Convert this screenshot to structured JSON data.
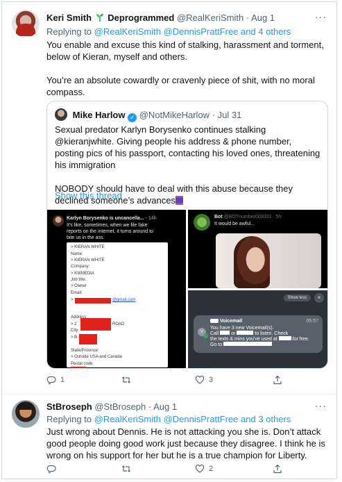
{
  "tweets": [
    {
      "display_name": "Keri Smith",
      "badge": "Deprogrammed",
      "handle": "@RealKeriSmith",
      "sep": "·",
      "date": "Aug 1",
      "replying_prefix": "Replying to",
      "replying_to": "@RealKeriSmith @DennisPrattFree and 4 others",
      "text_p1": "You enable and excuse this kind of stalking, harassment and torment, below of Kieran, myself and others.",
      "text_p2": "You’re an absolute cowardly or cravenly piece of shit, with no moral compass.",
      "actions": {
        "reply_count": "1",
        "retweet_count": "",
        "like_count": "3"
      }
    },
    {
      "display_name": "StBroseph",
      "handle": "@StBroseph",
      "sep": "·",
      "date": "Aug 1",
      "replying_prefix": "Replying to",
      "replying_to": "@RealKeriSmith @DennisPrattFree and 3 others",
      "text": "Just wrong about Dennis. He is not attacking you she is. Don’t attack good people doing good work just because they disagree. I think he is wrong on his support for her but he is a true champion for Liberty.",
      "actions": {
        "reply_count": "",
        "retweet_count": "",
        "like_count": "2"
      }
    }
  ],
  "quote": {
    "display_name": "Mike Harlow",
    "handle": "@NotMikeHarlow",
    "sep": "·",
    "date": "Jul 31",
    "text_p1": "Sexual predator Karlyn Borysenko continues stalking @kieranjwhite. Giving people his address & phone number, posting pics of his passport, contacting his loved ones, threatening his immigration",
    "text_p2": "NOBODY should have to deal with this abuse because they declined someone’s advances",
    "show_thread": "Show this thread"
  },
  "media": {
    "img1": {
      "author": "Karlyn Borysenko is uncancella...",
      "time": "· 14h",
      "text1": "It's like, sometimes, when we file fake",
      "text2": "reports on the internet, it turns around to",
      "text3": "bite us in the ass.",
      "card_lines": [
        "> KIERAN WHITE",
        "Name:",
        "> KIERAN WHITE",
        "Company:",
        "> KWMEDIA",
        "Job title:",
        "> Owner",
        "Email:",
        ">",
        "",
        "Address:",
        "> 2",
        "City:",
        "> B",
        "",
        "State/Province:",
        "> Outside USA and Canada",
        "Postal code:"
      ],
      "email_suffix": "@gmail.com",
      "road": "ROAD"
    },
    "img2": {
      "author": "Bot",
      "handle": "@BOTnumber000001 · 5h",
      "text": "It would be awful..."
    },
    "img3": {
      "show_less": "Show less",
      "close": "×",
      "title": "Voicemail",
      "time": "05:57",
      "line1": "You have 3 new Voicemail(s).",
      "line2a": "Call",
      "line2b": "or",
      "line2c": "to listen. Check",
      "line3a": "the texts & mins you've used at",
      "line3b": "for free.",
      "line4": "Go to"
    }
  },
  "colors": {
    "link": "#1d9bf0",
    "muted": "#536471",
    "text": "#0f1419",
    "border": "#cfd9de"
  },
  "icons": [
    "sprout-icon",
    "more-icon",
    "verified-icon",
    "reply-icon",
    "retweet-icon",
    "like-icon",
    "share-icon",
    "spool-emoji"
  ]
}
